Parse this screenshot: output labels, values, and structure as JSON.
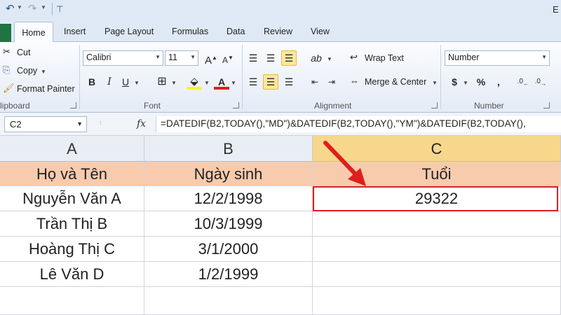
{
  "window": {
    "title_fragment": "E"
  },
  "ribbon_tabs": [
    "Home",
    "Insert",
    "Page Layout",
    "Formulas",
    "Data",
    "Review",
    "View"
  ],
  "clipboard": {
    "cut": "Cut",
    "copy": "Copy",
    "format_painter": "Format Painter",
    "group_label": "lipboard"
  },
  "font": {
    "name": "Calibri",
    "size": "11",
    "group_label": "Font"
  },
  "alignment": {
    "wrap_text": "Wrap Text",
    "merge_center": "Merge & Center",
    "group_label": "Alignment"
  },
  "number": {
    "format": "Number",
    "currency": "$",
    "percent": "%",
    "comma": ",",
    "group_label": "Number"
  },
  "formula_bar": {
    "name_box": "C2",
    "fx": "fx",
    "formula": "=DATEDIF(B2,TODAY(),\"MD\")&DATEDIF(B2,TODAY(),\"YM\")&DATEDIF(B2,TODAY(),"
  },
  "sheet": {
    "columns": [
      "A",
      "B",
      "C"
    ],
    "selected_column": "C",
    "header_row": [
      "Họ và Tên",
      "Ngày sinh",
      "Tuổi"
    ],
    "rows": [
      [
        "Nguyễn Văn A",
        "12/2/1998",
        "29322"
      ],
      [
        "Trần Thị B",
        "10/3/1999",
        ""
      ],
      [
        "Hoàng Thị C",
        "3/1/2000",
        ""
      ],
      [
        "Lê Văn D",
        "1/2/1999",
        ""
      ],
      [
        "",
        "",
        ""
      ]
    ],
    "selected_cell": "C2"
  },
  "colors": {
    "header_fill": "#f8cbad",
    "selection_border": "#e01e1e",
    "arrow": "#e01e1e",
    "file_tab": "#217346"
  },
  "icons": [
    "undo-icon",
    "redo-icon",
    "cut-icon",
    "copy-icon",
    "format-painter-icon",
    "bold-icon",
    "italic-icon",
    "underline-icon",
    "borders-icon",
    "fill-color-icon",
    "font-color-icon",
    "align-top-icon",
    "align-middle-icon",
    "align-bottom-icon",
    "orientation-icon",
    "align-left-icon",
    "align-center-icon",
    "align-right-icon",
    "decrease-indent-icon",
    "increase-indent-icon",
    "wrap-text-icon",
    "merge-center-icon",
    "increase-decimal-icon",
    "decrease-decimal-icon",
    "red-arrow-icon"
  ]
}
